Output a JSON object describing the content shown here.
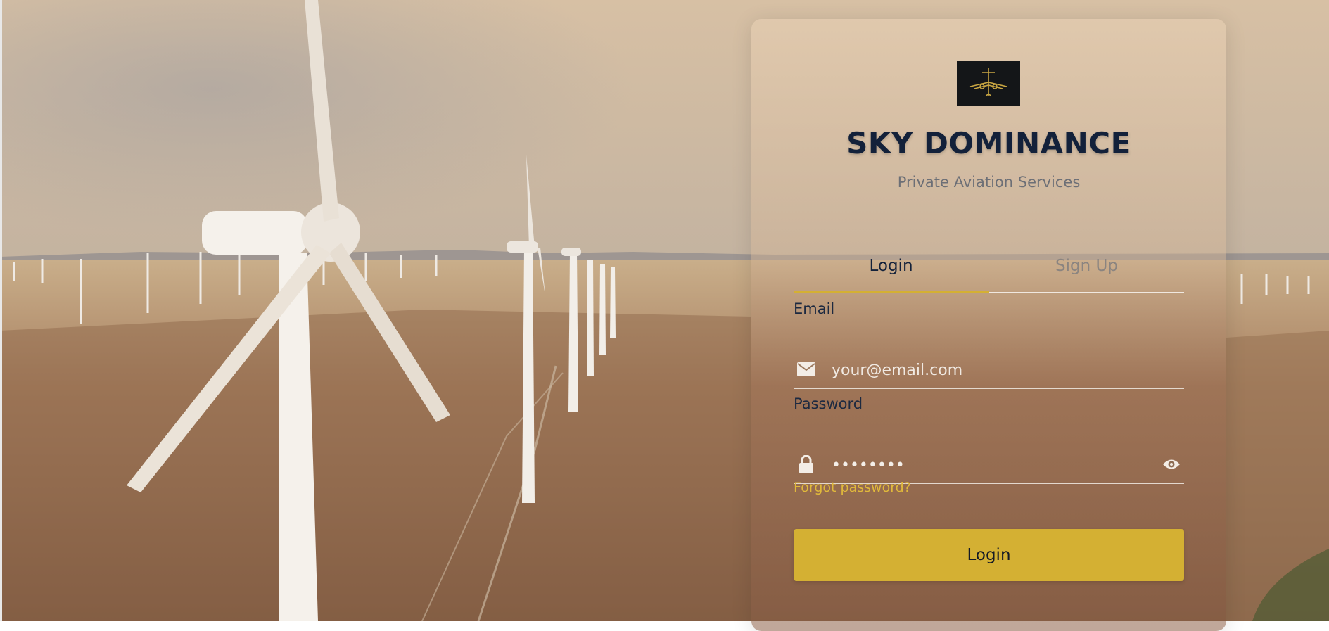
{
  "brand": {
    "logo_icon": "jet-icon",
    "name": "SKY DOMINANCE",
    "tagline": "Private Aviation Services"
  },
  "tabs": {
    "login_label": "Login",
    "signup_label": "Sign Up",
    "active": "Login"
  },
  "form": {
    "email_label": "Email",
    "email_placeholder": "your@email.com",
    "email_icon": "envelope-icon",
    "password_label": "Password",
    "password_value": "••••••••",
    "password_icon": "lock-icon",
    "show_password_icon": "eye-icon",
    "forgot_link": "Forgot password?",
    "submit_label": "Login"
  },
  "colors": {
    "accent": "#d4b033",
    "brand_text": "#13213a",
    "link": "#e0b93b"
  }
}
